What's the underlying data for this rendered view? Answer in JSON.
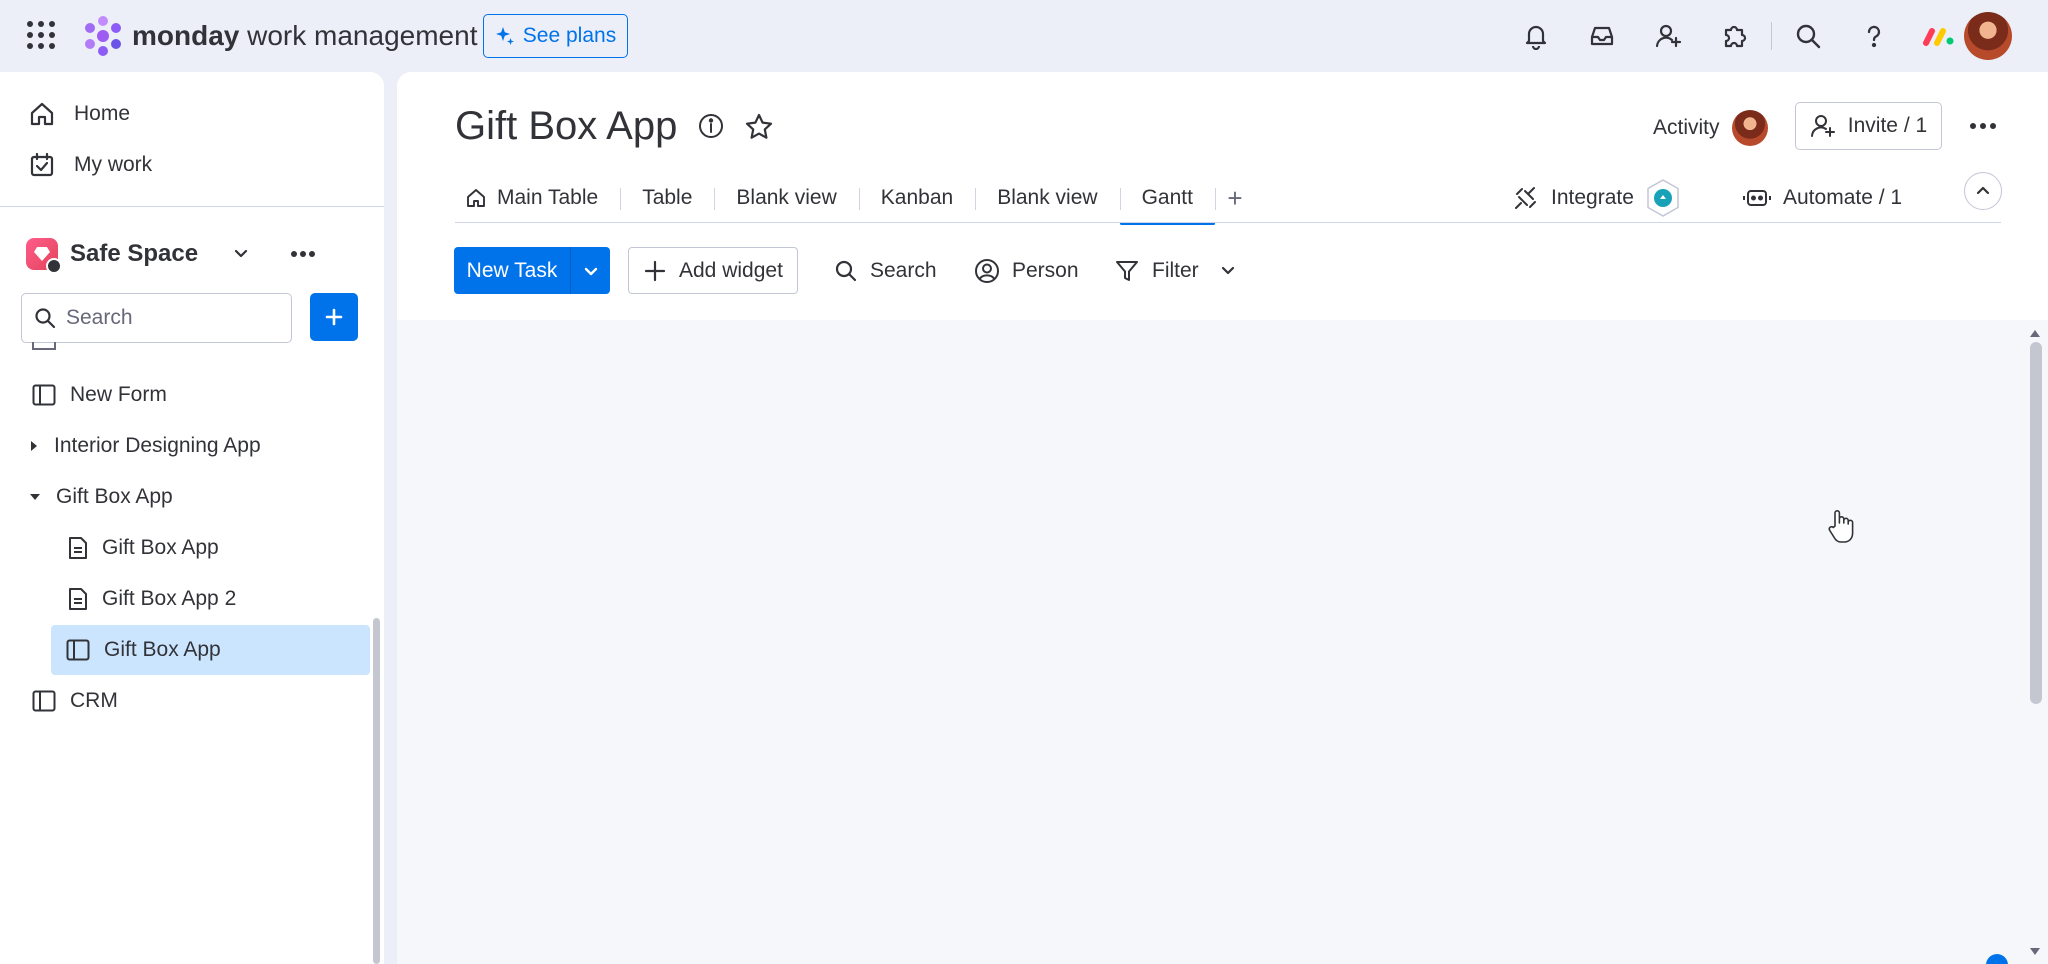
{
  "topbar": {
    "brand_bold": "monday",
    "brand_rest": " work management",
    "see_plans": "See plans"
  },
  "sidebar": {
    "home": "Home",
    "my_work": "My work",
    "workspace": "Safe Space",
    "search_placeholder": "Search",
    "tree": [
      {
        "label": "New Form"
      },
      {
        "label": "Interior Designing App"
      },
      {
        "label": "Gift Box App"
      },
      {
        "label": "Gift Box App"
      },
      {
        "label": "Gift Box App 2"
      },
      {
        "label": "Gift Box App"
      },
      {
        "label": "CRM"
      }
    ]
  },
  "board": {
    "title": "Gift Box App",
    "activity": "Activity",
    "invite": "Invite / 1",
    "tabs": [
      {
        "label": "Main Table"
      },
      {
        "label": "Table"
      },
      {
        "label": "Blank view"
      },
      {
        "label": "Kanban"
      },
      {
        "label": "Blank view"
      },
      {
        "label": "Gantt"
      }
    ],
    "tab_add": "+",
    "integrate": "Integrate",
    "automate": "Automate / 1"
  },
  "toolbar": {
    "new_task": "New Task",
    "add_widget": "Add widget",
    "search": "Search",
    "person": "Person",
    "filter": "Filter"
  },
  "colors": {
    "accent": "#0073ea",
    "selected_bg": "#cce5ff",
    "app_bg": "#eceff8"
  }
}
